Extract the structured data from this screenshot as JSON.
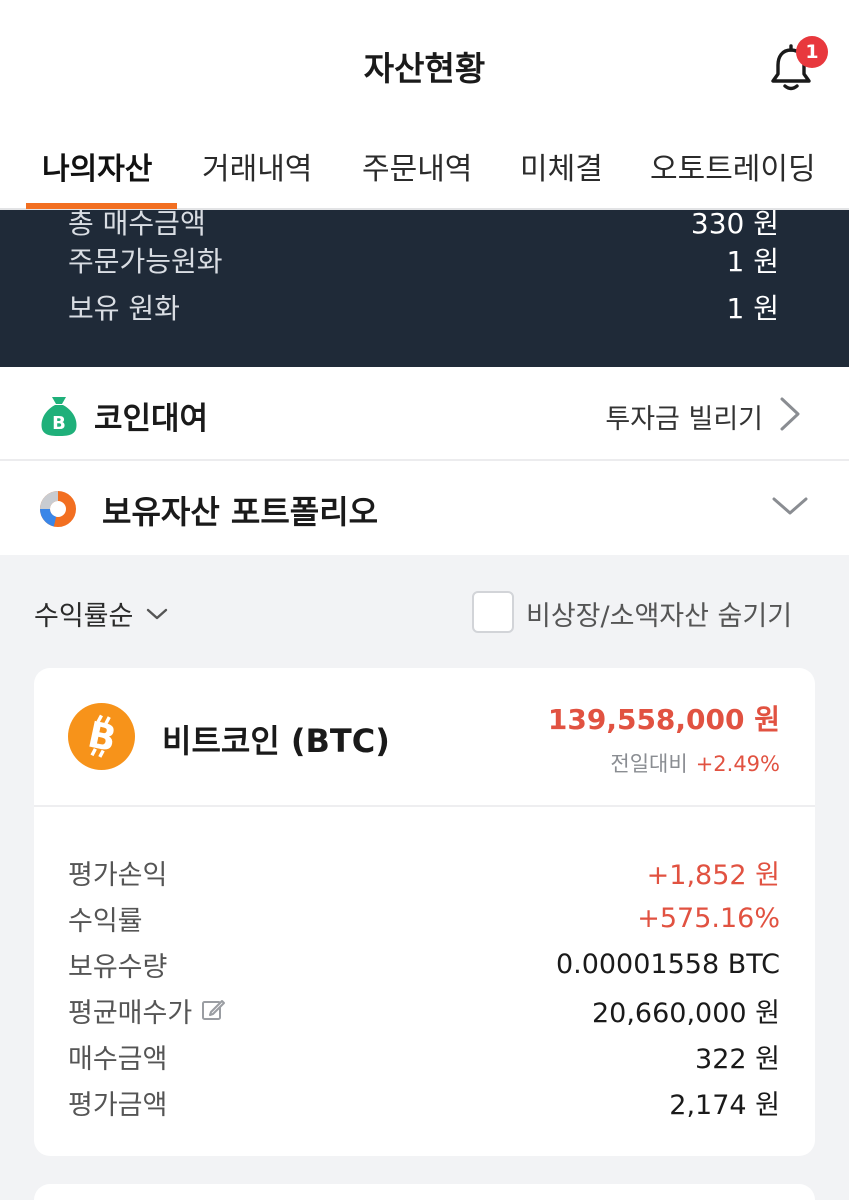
{
  "header": {
    "title": "자산현황",
    "badge_count": "1"
  },
  "tabs": [
    {
      "label": "나의자산",
      "active": true
    },
    {
      "label": "거래내역",
      "active": false
    },
    {
      "label": "주문내역",
      "active": false
    },
    {
      "label": "미체결",
      "active": false
    },
    {
      "label": "오토트레이딩",
      "active": false
    }
  ],
  "summary": {
    "rows": [
      {
        "label": "총 매수금액",
        "value": "330 원"
      },
      {
        "label": "주문가능원화",
        "value": "1 원"
      },
      {
        "label": "보유 원화",
        "value": "1 원"
      }
    ]
  },
  "loan": {
    "icon": "money-bag-icon",
    "title": "코인대여",
    "link": "투자금 빌리기"
  },
  "portfolio": {
    "icon": "donut-chart-icon",
    "title": "보유자산 포트폴리오"
  },
  "filters": {
    "sort_label": "수익률순",
    "hide_label": "비상장/소액자산 숨기기",
    "hide_checked": false
  },
  "asset": {
    "icon": "bitcoin-icon",
    "name": "비트코인 (BTC)",
    "price": "139,558,000 원",
    "change_label": "전일대비",
    "change_pct": "+2.49%",
    "details": [
      {
        "label": "평가손익",
        "value": "+1,852 원",
        "highlight": true
      },
      {
        "label": "수익률",
        "value": "+575.16%",
        "highlight": true
      },
      {
        "label": "보유수량",
        "value": "0.00001558 BTC",
        "highlight": false
      },
      {
        "label": "평균매수가",
        "value": "20,660,000 원",
        "highlight": false,
        "editable": true
      },
      {
        "label": "매수금액",
        "value": "322 원",
        "highlight": false
      },
      {
        "label": "평가금액",
        "value": "2,174 원",
        "highlight": false
      }
    ]
  },
  "colors": {
    "accent": "#f26f21",
    "up": "#e15241",
    "dark_panel": "#1f2a38",
    "bitcoin": "#f7931a",
    "loan_green": "#1fb07a"
  }
}
